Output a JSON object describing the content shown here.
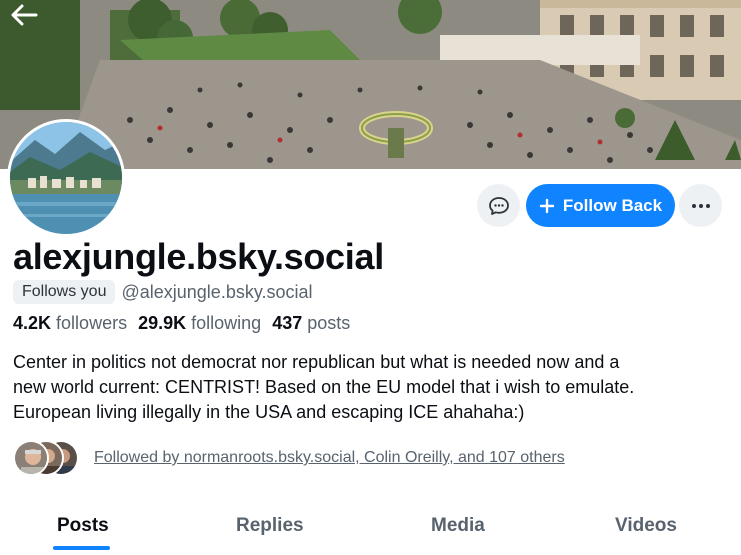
{
  "banner": {
    "back_icon": "arrow-left-icon"
  },
  "actions": {
    "message_icon": "message-bubble-icon",
    "follow_label": "Follow Back",
    "follow_icon": "plus-icon",
    "more_icon": "ellipsis-icon"
  },
  "profile": {
    "display_name": "alexjungle.bsky.social",
    "follows_you": "Follows you",
    "handle": "@alexjungle.bsky.social",
    "stats": {
      "followers_count": "4.2K",
      "followers_label": "followers",
      "following_count": "29.9K",
      "following_label": "following",
      "posts_count": "437",
      "posts_label": "posts"
    },
    "bio_lines": [
      "Center in politics not democrat nor republican but what is needed now and a",
      "new world current: CENTRIST! Based on the EU model that i wish to emulate.",
      "European living illegally in the USA and escaping ICE ahahaha:)"
    ],
    "followed_by": "Followed by normanroots.bsky.social, Colin Oreilly, and 107 others"
  },
  "tabs": [
    {
      "label": "Posts",
      "active": true
    },
    {
      "label": "Replies",
      "active": false
    },
    {
      "label": "Media",
      "active": false
    },
    {
      "label": "Videos",
      "active": false
    }
  ],
  "colors": {
    "accent": "#1083fe",
    "muted": "#59636e",
    "text": "#0b0f14"
  }
}
